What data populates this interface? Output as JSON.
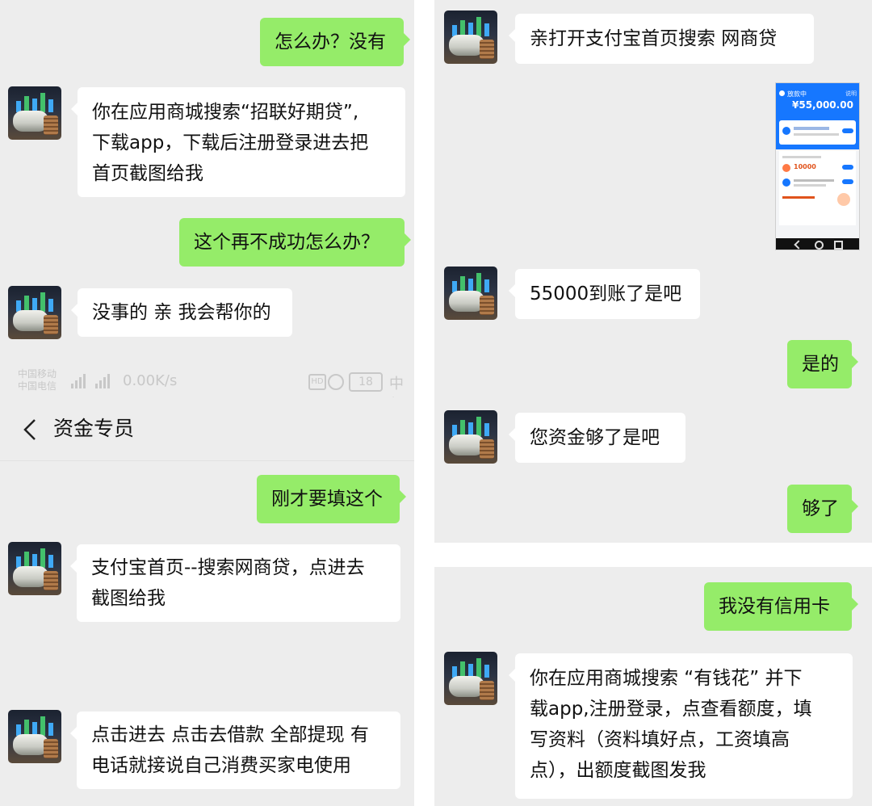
{
  "colors": {
    "panel_bg": "#ededed",
    "incoming_bubble": "#ffffff",
    "outgoing_bubble": "#95ec69",
    "alipay_blue": "#1677ff"
  },
  "panel_top_left": {
    "messages": [
      {
        "from": "me",
        "lines": [
          "怎么办？没有"
        ]
      },
      {
        "from": "agent",
        "lines": [
          "你在应用商城搜索“招联好期贷”,",
          "下载app，下载后注册登录进去把",
          "首页截图给我"
        ]
      },
      {
        "from": "me",
        "lines": [
          "这个再不成功怎么办？"
        ]
      },
      {
        "from": "agent",
        "lines": [
          "没事的 亲 我会帮你的"
        ]
      }
    ]
  },
  "status_bar": {
    "carrier_1": "中国移动",
    "carrier_2": "中国电信",
    "speed": "0.00K/s",
    "battery": "18",
    "time_partial": "中午"
  },
  "chat_header": {
    "back_icon": "chevron-left-icon",
    "title": "资金专员"
  },
  "panel_bottom_left": {
    "messages": [
      {
        "from": "me",
        "lines": [
          "刚才要填这个"
        ]
      },
      {
        "from": "agent",
        "lines": [
          "支付宝首页--搜索网商贷，点进去",
          "截图给我"
        ]
      },
      {
        "from": "agent",
        "lines": [
          "点击进去  点击去借款 全部提现 有",
          "电话就接说自己消费买家电使用"
        ]
      }
    ]
  },
  "panel_top_right": {
    "messages": [
      {
        "from": "agent",
        "lines": [
          "亲打开支付宝首页搜索 网商贷"
        ]
      },
      {
        "from": "agent",
        "type": "image"
      },
      {
        "from": "agent",
        "lines": [
          "55000到账了是吧"
        ]
      },
      {
        "from": "me",
        "lines": [
          "是的"
        ]
      },
      {
        "from": "agent",
        "lines": [
          "您资金够了是吧"
        ]
      },
      {
        "from": "me",
        "lines": [
          "够了"
        ]
      }
    ],
    "screenshot": {
      "status": "放款中",
      "amount": "¥55,000.00",
      "link": "说明",
      "promo_amount": "10000"
    }
  },
  "panel_bottom_right": {
    "messages": [
      {
        "from": "me",
        "lines": [
          "我没有信用卡"
        ]
      },
      {
        "from": "agent",
        "lines": [
          "你在应用商城搜索 “有钱花” 并下",
          "载app,注册登录，点查看额度，填",
          "写资料（资料填好点，工资填高",
          "点），出额度截图发我"
        ]
      }
    ]
  }
}
